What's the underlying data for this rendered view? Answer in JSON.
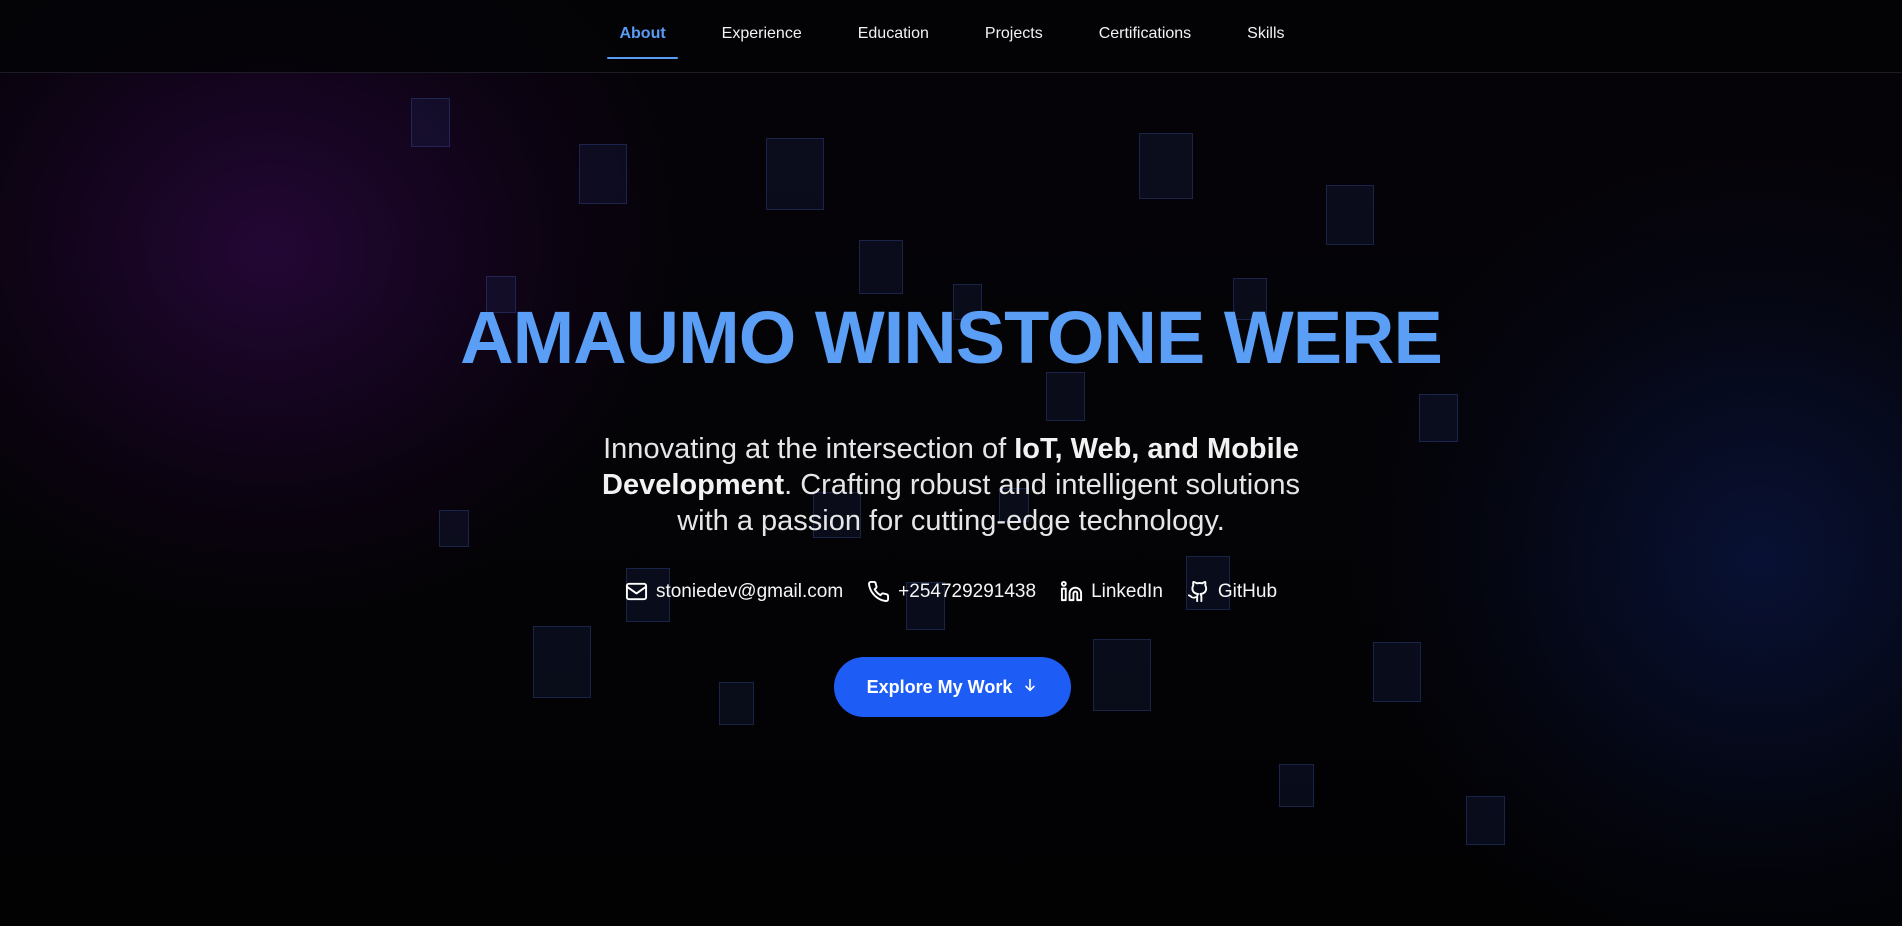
{
  "nav": {
    "items": [
      {
        "label": "About",
        "active": true
      },
      {
        "label": "Experience",
        "active": false
      },
      {
        "label": "Education",
        "active": false
      },
      {
        "label": "Projects",
        "active": false
      },
      {
        "label": "Certifications",
        "active": false
      },
      {
        "label": "Skills",
        "active": false
      }
    ]
  },
  "hero": {
    "name": "AMAUMO WINSTONE WERE",
    "tagline_prefix": "Innovating at the intersection of ",
    "tagline_bold": "IoT, Web, and Mobile Development",
    "tagline_suffix": ". Crafting robust and intelligent solutions with a passion for cutting-edge technology.",
    "contacts": [
      {
        "icon": "mail-icon",
        "label": "stoniedev@gmail.com"
      },
      {
        "icon": "phone-icon",
        "label": "+254729291438"
      },
      {
        "icon": "linkedin-icon",
        "label": "LinkedIn"
      },
      {
        "icon": "github-icon",
        "label": "GitHub"
      }
    ],
    "cta_label": "Explore My Work",
    "cta_icon": "arrow-down-icon"
  },
  "colors": {
    "accent": "#5a9ef5",
    "button": "#1d5df5",
    "background": "#020205"
  }
}
